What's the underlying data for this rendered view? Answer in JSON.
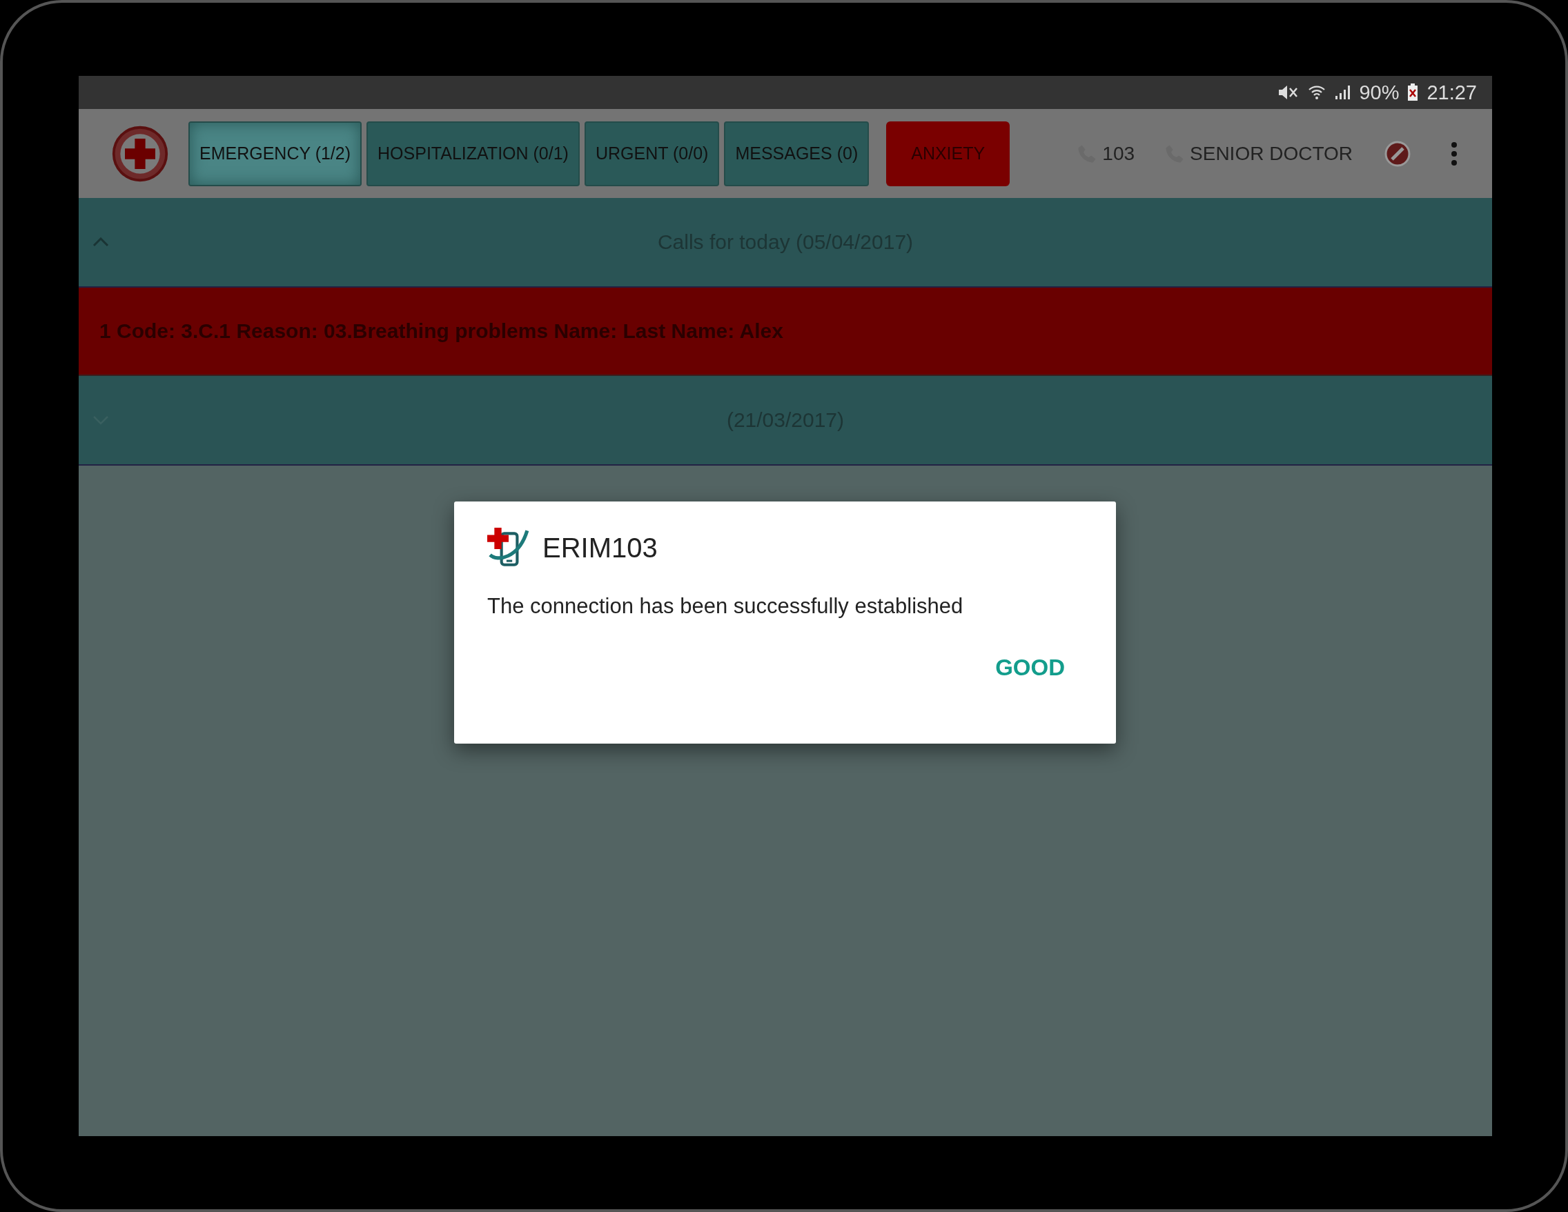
{
  "status_bar": {
    "battery": "90%",
    "time": "21:27"
  },
  "app_bar": {
    "tabs": [
      {
        "label": "EMERGENCY (1/2)",
        "selected": true
      },
      {
        "label": "HOSPITALIZATION (0/1)",
        "selected": false
      },
      {
        "label": "URGENT (0/0)",
        "selected": false
      },
      {
        "label": "MESSAGES (0)",
        "selected": false
      }
    ],
    "alert_button": "ANXIETY",
    "phone_line": "103",
    "role": "SENIOR DOCTOR"
  },
  "list": [
    {
      "kind": "header",
      "label": "Calls for today (05/04/2017)",
      "expanded": true
    },
    {
      "kind": "call",
      "text": "1 Code: 3.C.1 Reason: 03.Breathing problems Name:  Last Name: Alex"
    },
    {
      "kind": "header",
      "label": "(21/03/2017)",
      "expanded": false
    }
  ],
  "dialog": {
    "title": "ERIM103",
    "message": "The connection has been successfully established",
    "button": "GOOD"
  }
}
